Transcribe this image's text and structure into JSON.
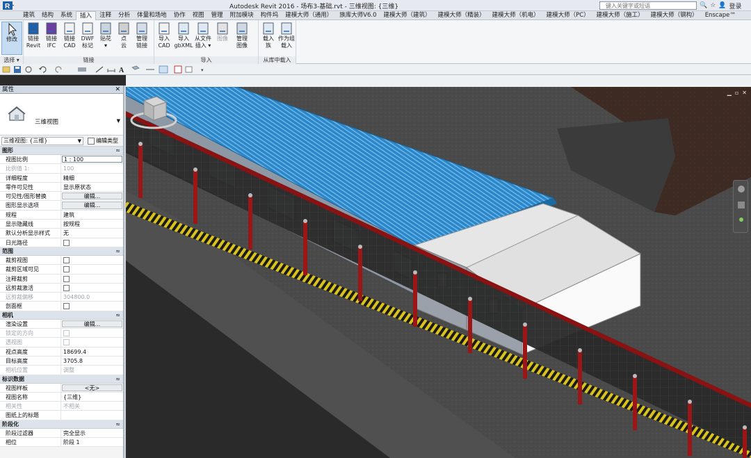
{
  "titlebar": {
    "title": "Autodesk Revit 2016 -    场布3-基础.rvt - 三维视图: {三维}",
    "search_placeholder": "键入关键字或短语",
    "login_label": "登录"
  },
  "ribbon_tabs": [
    {
      "label": "建筑"
    },
    {
      "label": "结构"
    },
    {
      "label": "系统"
    },
    {
      "label": "插入",
      "active": true
    },
    {
      "label": "注释"
    },
    {
      "label": "分析"
    },
    {
      "label": "体量和场地"
    },
    {
      "label": "协作"
    },
    {
      "label": "视图"
    },
    {
      "label": "管理"
    },
    {
      "label": "附加模块"
    },
    {
      "label": "构件坞"
    },
    {
      "label": "建模大师（通用）"
    },
    {
      "label": "族库大师V6.0"
    },
    {
      "label": "建模大师（建筑）"
    },
    {
      "label": "建模大师（精装）"
    },
    {
      "label": "建模大师（机电）"
    },
    {
      "label": "建模大师（PC）"
    },
    {
      "label": "建模大师（施工）"
    },
    {
      "label": "建模大师（钢构）"
    },
    {
      "label": "Enscape™"
    }
  ],
  "ribbon": {
    "select_group": {
      "modify_label": "修改",
      "title": "选择 ▾"
    },
    "link_group": {
      "title": "链接",
      "buttons": [
        {
          "label": "链接\nRevit",
          "icon": "revit-link-icon"
        },
        {
          "label": "链接\nIFC",
          "icon": "ifc-link-icon"
        },
        {
          "label": "链接\nCAD",
          "icon": "cad-link-icon"
        },
        {
          "label": "DWF\n标记",
          "icon": "dwf-markup-icon"
        },
        {
          "label": "贴花\n▾",
          "icon": "decal-icon"
        },
        {
          "label": "点\n云",
          "icon": "point-cloud-icon"
        },
        {
          "label": "管理\n链接",
          "icon": "manage-links-icon"
        }
      ]
    },
    "import_group": {
      "title": "导入",
      "buttons": [
        {
          "label": "导入\nCAD",
          "icon": "import-cad-icon"
        },
        {
          "label": "导入\ngbXML",
          "icon": "import-gbxml-icon"
        },
        {
          "label": "从文件\n插入 ▾",
          "icon": "insert-from-file-icon"
        },
        {
          "label": "图像",
          "icon": "image-icon",
          "disabled": true
        },
        {
          "label": "管理\n图像",
          "icon": "manage-images-icon"
        }
      ]
    },
    "library_group": {
      "title": "从库中载入",
      "buttons": [
        {
          "label": "载入\n族",
          "icon": "load-family-icon"
        },
        {
          "label": "作为组\n载入",
          "icon": "load-as-group-icon"
        }
      ]
    }
  },
  "properties": {
    "header": "属性",
    "type_name": "三维视图",
    "instance_selector": "三维视图: {三维}",
    "edit_type_label": "编辑类型",
    "sections": [
      {
        "title": "图形",
        "rows": [
          {
            "k": "视图比例",
            "v": "1 : 100",
            "kind": "input"
          },
          {
            "k": "比例值 1:",
            "v": "100",
            "dim": true
          },
          {
            "k": "详细程度",
            "v": "精细"
          },
          {
            "k": "零件可见性",
            "v": "显示原状态"
          },
          {
            "k": "可见性/图形替换",
            "v": "编辑...",
            "kind": "button"
          },
          {
            "k": "图形显示选项",
            "v": "编辑...",
            "kind": "button"
          },
          {
            "k": "规程",
            "v": "建筑"
          },
          {
            "k": "显示隐藏线",
            "v": "按规程"
          },
          {
            "k": "默认分析显示样式",
            "v": "无"
          },
          {
            "k": "日光路径",
            "v": "",
            "kind": "check"
          }
        ]
      },
      {
        "title": "范围",
        "rows": [
          {
            "k": "裁剪视图",
            "v": "",
            "kind": "check"
          },
          {
            "k": "裁剪区域可见",
            "v": "",
            "kind": "check"
          },
          {
            "k": "注释裁剪",
            "v": "",
            "kind": "check"
          },
          {
            "k": "远剪裁激活",
            "v": "",
            "kind": "check"
          },
          {
            "k": "远剪裁偏移",
            "v": "304800.0",
            "dim": true
          },
          {
            "k": "剖面框",
            "v": "",
            "kind": "check"
          }
        ]
      },
      {
        "title": "相机",
        "rows": [
          {
            "k": "渲染设置",
            "v": "编辑...",
            "kind": "button"
          },
          {
            "k": "锁定的方向",
            "v": "",
            "kind": "check",
            "dim": true
          },
          {
            "k": "透视图",
            "v": "",
            "kind": "check",
            "dim": true
          },
          {
            "k": "视点高度",
            "v": "18699.4"
          },
          {
            "k": "目标高度",
            "v": "3705.8"
          },
          {
            "k": "相机位置",
            "v": "调整",
            "dim": true
          }
        ]
      },
      {
        "title": "标识数据",
        "rows": [
          {
            "k": "视图样板",
            "v": "<无>",
            "kind": "button"
          },
          {
            "k": "视图名称",
            "v": "{三维}"
          },
          {
            "k": "相关性",
            "v": "不相关",
            "dim": true
          },
          {
            "k": "图纸上的标题",
            "v": ""
          }
        ]
      },
      {
        "title": "阶段化",
        "rows": [
          {
            "k": "阶段过滤器",
            "v": "完全显示"
          },
          {
            "k": "相位",
            "v": "阶段 1"
          }
        ]
      }
    ]
  },
  "viewport": {
    "controls": [
      "▁",
      "▫",
      "✕"
    ]
  }
}
